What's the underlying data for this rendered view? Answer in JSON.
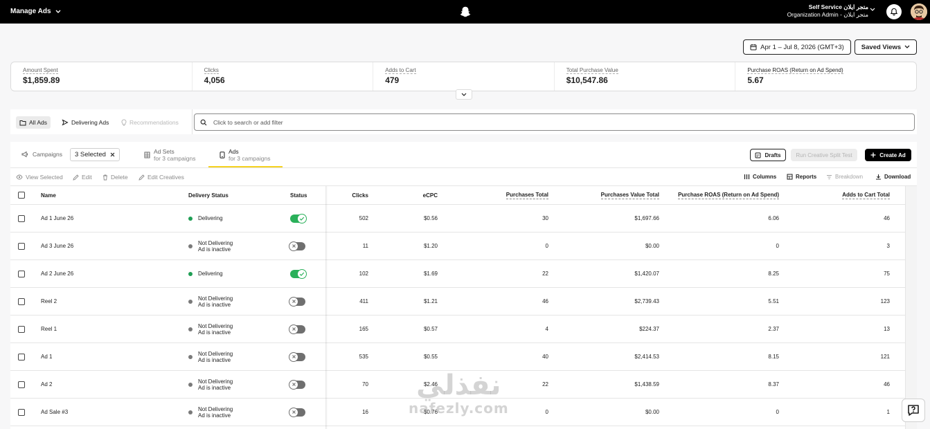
{
  "topbar": {
    "title": "Manage Ads",
    "account_name": "Self Service متجر ايلان",
    "account_role": "Organization Admin - متجر ايلان"
  },
  "date_range": "Apr 1 – Jul 8, 2026 (GMT+3)",
  "saved_views": "Saved Views",
  "stats": [
    {
      "label": "Amount Spent",
      "value": "$1,859.89"
    },
    {
      "label": "Clicks",
      "value": "4,056"
    },
    {
      "label": "Adds to Cart",
      "value": "479"
    },
    {
      "label": "Total Purchase Value",
      "value": "$10,547.86"
    },
    {
      "label": "Purchase ROAS (Return on Ad Spend)",
      "value": "5.67"
    }
  ],
  "view_tabs": {
    "all": "All Ads",
    "delivering": "Delivering Ads",
    "recommendations": "Recommendations"
  },
  "search": {
    "placeholder": "Click to search or add filter"
  },
  "levels": {
    "campaigns": "Campaigns",
    "selected_chip": "3 Selected",
    "adsets": "Ad Sets",
    "adsets_sub": "for 3 campaigns",
    "ads": "Ads",
    "ads_sub": "for 3 campaigns"
  },
  "panel_buttons": {
    "drafts": "Drafts",
    "split_test": "Run Creative Split Test",
    "create_ad": "Create Ad"
  },
  "actions": {
    "view_selected": "View Selected",
    "edit": "Edit",
    "delete": "Delete",
    "edit_creatives": "Edit Creatives",
    "columns": "Columns",
    "reports": "Reports",
    "breakdown": "Breakdown",
    "download": "Download"
  },
  "table": {
    "columns": {
      "name": "Name",
      "delivery": "Delivery Status",
      "status": "Status",
      "clicks": "Clicks",
      "ecpc": "eCPC",
      "purchases_total": "Purchases Total",
      "purchases_value_total": "Purchases Value Total",
      "roas": "Purchase ROAS (Return on Ad Spend)",
      "adds_to_cart_total": "Adds to Cart Total"
    },
    "rows": [
      {
        "name": "Ad 1 June 26",
        "delivery": "Delivering",
        "delivery_sub": "",
        "on": true,
        "clicks": "502",
        "ecpc": "$0.56",
        "purchases": "30",
        "value": "$1,697.66",
        "roas": "6.06",
        "atc": "46"
      },
      {
        "name": "Ad 3 June 26",
        "delivery": "Not Delivering",
        "delivery_sub": "Ad is inactive",
        "on": false,
        "clicks": "11",
        "ecpc": "$1.20",
        "purchases": "0",
        "value": "$0.00",
        "roas": "0",
        "atc": "3"
      },
      {
        "name": "Ad 2 June 26",
        "delivery": "Delivering",
        "delivery_sub": "",
        "on": true,
        "clicks": "102",
        "ecpc": "$1.69",
        "purchases": "22",
        "value": "$1,420.07",
        "roas": "8.25",
        "atc": "75"
      },
      {
        "name": "Reel 2",
        "delivery": "Not Delivering",
        "delivery_sub": "Ad is inactive",
        "on": false,
        "clicks": "411",
        "ecpc": "$1.21",
        "purchases": "46",
        "value": "$2,739.43",
        "roas": "5.51",
        "atc": "123"
      },
      {
        "name": "Reel 1",
        "delivery": "Not Delivering",
        "delivery_sub": "Ad is inactive",
        "on": false,
        "clicks": "165",
        "ecpc": "$0.57",
        "purchases": "4",
        "value": "$224.37",
        "roas": "2.37",
        "atc": "13"
      },
      {
        "name": "Ad 1",
        "delivery": "Not Delivering",
        "delivery_sub": "Ad is inactive",
        "on": false,
        "clicks": "535",
        "ecpc": "$0.55",
        "purchases": "40",
        "value": "$2,414.53",
        "roas": "8.15",
        "atc": "121"
      },
      {
        "name": "Ad 2",
        "delivery": "Not Delivering",
        "delivery_sub": "Ad is inactive",
        "on": false,
        "clicks": "70",
        "ecpc": "$2.46",
        "purchases": "22",
        "value": "$1,438.59",
        "roas": "8.37",
        "atc": "46"
      },
      {
        "name": "Ad Sale #3",
        "delivery": "Not Delivering",
        "delivery_sub": "Ad is inactive",
        "on": false,
        "clicks": "16",
        "ecpc": "$0.76",
        "purchases": "0",
        "value": "$0.00",
        "roas": "0",
        "atc": "1"
      }
    ]
  },
  "watermark": {
    "arabic": "نفذلي",
    "latin": "nafezly.com"
  },
  "colors": {
    "delivering": "#1f9e54",
    "toggle_on": "#2ab05a",
    "tab_underline": "#f5d21f"
  }
}
